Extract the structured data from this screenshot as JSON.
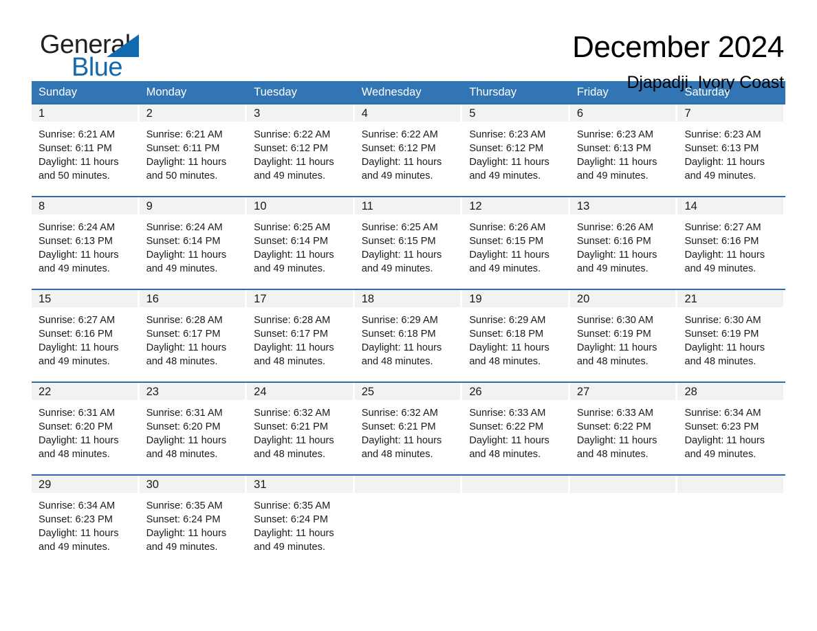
{
  "brand": {
    "name_part1": "General",
    "name_part2": "Blue",
    "triangle_color": "#1369ae",
    "text_color": "#231f20"
  },
  "header": {
    "month_title": "December 2024",
    "location": "Djapadji, Ivory Coast"
  },
  "colors": {
    "header_row_bg": "#3275b4",
    "header_row_text": "#ffffff",
    "week_divider": "#2d6ca8",
    "day_band_bg": "#f2f2f2",
    "body_text": "#1a1a1a"
  },
  "weekdays": [
    "Sunday",
    "Monday",
    "Tuesday",
    "Wednesday",
    "Thursday",
    "Friday",
    "Saturday"
  ],
  "weeks": [
    [
      {
        "day": "1",
        "sunrise": "Sunrise: 6:21 AM",
        "sunset": "Sunset: 6:11 PM",
        "daylight1": "Daylight: 11 hours",
        "daylight2": "and 50 minutes."
      },
      {
        "day": "2",
        "sunrise": "Sunrise: 6:21 AM",
        "sunset": "Sunset: 6:11 PM",
        "daylight1": "Daylight: 11 hours",
        "daylight2": "and 50 minutes."
      },
      {
        "day": "3",
        "sunrise": "Sunrise: 6:22 AM",
        "sunset": "Sunset: 6:12 PM",
        "daylight1": "Daylight: 11 hours",
        "daylight2": "and 49 minutes."
      },
      {
        "day": "4",
        "sunrise": "Sunrise: 6:22 AM",
        "sunset": "Sunset: 6:12 PM",
        "daylight1": "Daylight: 11 hours",
        "daylight2": "and 49 minutes."
      },
      {
        "day": "5",
        "sunrise": "Sunrise: 6:23 AM",
        "sunset": "Sunset: 6:12 PM",
        "daylight1": "Daylight: 11 hours",
        "daylight2": "and 49 minutes."
      },
      {
        "day": "6",
        "sunrise": "Sunrise: 6:23 AM",
        "sunset": "Sunset: 6:13 PM",
        "daylight1": "Daylight: 11 hours",
        "daylight2": "and 49 minutes."
      },
      {
        "day": "7",
        "sunrise": "Sunrise: 6:23 AM",
        "sunset": "Sunset: 6:13 PM",
        "daylight1": "Daylight: 11 hours",
        "daylight2": "and 49 minutes."
      }
    ],
    [
      {
        "day": "8",
        "sunrise": "Sunrise: 6:24 AM",
        "sunset": "Sunset: 6:13 PM",
        "daylight1": "Daylight: 11 hours",
        "daylight2": "and 49 minutes."
      },
      {
        "day": "9",
        "sunrise": "Sunrise: 6:24 AM",
        "sunset": "Sunset: 6:14 PM",
        "daylight1": "Daylight: 11 hours",
        "daylight2": "and 49 minutes."
      },
      {
        "day": "10",
        "sunrise": "Sunrise: 6:25 AM",
        "sunset": "Sunset: 6:14 PM",
        "daylight1": "Daylight: 11 hours",
        "daylight2": "and 49 minutes."
      },
      {
        "day": "11",
        "sunrise": "Sunrise: 6:25 AM",
        "sunset": "Sunset: 6:15 PM",
        "daylight1": "Daylight: 11 hours",
        "daylight2": "and 49 minutes."
      },
      {
        "day": "12",
        "sunrise": "Sunrise: 6:26 AM",
        "sunset": "Sunset: 6:15 PM",
        "daylight1": "Daylight: 11 hours",
        "daylight2": "and 49 minutes."
      },
      {
        "day": "13",
        "sunrise": "Sunrise: 6:26 AM",
        "sunset": "Sunset: 6:16 PM",
        "daylight1": "Daylight: 11 hours",
        "daylight2": "and 49 minutes."
      },
      {
        "day": "14",
        "sunrise": "Sunrise: 6:27 AM",
        "sunset": "Sunset: 6:16 PM",
        "daylight1": "Daylight: 11 hours",
        "daylight2": "and 49 minutes."
      }
    ],
    [
      {
        "day": "15",
        "sunrise": "Sunrise: 6:27 AM",
        "sunset": "Sunset: 6:16 PM",
        "daylight1": "Daylight: 11 hours",
        "daylight2": "and 49 minutes."
      },
      {
        "day": "16",
        "sunrise": "Sunrise: 6:28 AM",
        "sunset": "Sunset: 6:17 PM",
        "daylight1": "Daylight: 11 hours",
        "daylight2": "and 48 minutes."
      },
      {
        "day": "17",
        "sunrise": "Sunrise: 6:28 AM",
        "sunset": "Sunset: 6:17 PM",
        "daylight1": "Daylight: 11 hours",
        "daylight2": "and 48 minutes."
      },
      {
        "day": "18",
        "sunrise": "Sunrise: 6:29 AM",
        "sunset": "Sunset: 6:18 PM",
        "daylight1": "Daylight: 11 hours",
        "daylight2": "and 48 minutes."
      },
      {
        "day": "19",
        "sunrise": "Sunrise: 6:29 AM",
        "sunset": "Sunset: 6:18 PM",
        "daylight1": "Daylight: 11 hours",
        "daylight2": "and 48 minutes."
      },
      {
        "day": "20",
        "sunrise": "Sunrise: 6:30 AM",
        "sunset": "Sunset: 6:19 PM",
        "daylight1": "Daylight: 11 hours",
        "daylight2": "and 48 minutes."
      },
      {
        "day": "21",
        "sunrise": "Sunrise: 6:30 AM",
        "sunset": "Sunset: 6:19 PM",
        "daylight1": "Daylight: 11 hours",
        "daylight2": "and 48 minutes."
      }
    ],
    [
      {
        "day": "22",
        "sunrise": "Sunrise: 6:31 AM",
        "sunset": "Sunset: 6:20 PM",
        "daylight1": "Daylight: 11 hours",
        "daylight2": "and 48 minutes."
      },
      {
        "day": "23",
        "sunrise": "Sunrise: 6:31 AM",
        "sunset": "Sunset: 6:20 PM",
        "daylight1": "Daylight: 11 hours",
        "daylight2": "and 48 minutes."
      },
      {
        "day": "24",
        "sunrise": "Sunrise: 6:32 AM",
        "sunset": "Sunset: 6:21 PM",
        "daylight1": "Daylight: 11 hours",
        "daylight2": "and 48 minutes."
      },
      {
        "day": "25",
        "sunrise": "Sunrise: 6:32 AM",
        "sunset": "Sunset: 6:21 PM",
        "daylight1": "Daylight: 11 hours",
        "daylight2": "and 48 minutes."
      },
      {
        "day": "26",
        "sunrise": "Sunrise: 6:33 AM",
        "sunset": "Sunset: 6:22 PM",
        "daylight1": "Daylight: 11 hours",
        "daylight2": "and 48 minutes."
      },
      {
        "day": "27",
        "sunrise": "Sunrise: 6:33 AM",
        "sunset": "Sunset: 6:22 PM",
        "daylight1": "Daylight: 11 hours",
        "daylight2": "and 48 minutes."
      },
      {
        "day": "28",
        "sunrise": "Sunrise: 6:34 AM",
        "sunset": "Sunset: 6:23 PM",
        "daylight1": "Daylight: 11 hours",
        "daylight2": "and 49 minutes."
      }
    ],
    [
      {
        "day": "29",
        "sunrise": "Sunrise: 6:34 AM",
        "sunset": "Sunset: 6:23 PM",
        "daylight1": "Daylight: 11 hours",
        "daylight2": "and 49 minutes."
      },
      {
        "day": "30",
        "sunrise": "Sunrise: 6:35 AM",
        "sunset": "Sunset: 6:24 PM",
        "daylight1": "Daylight: 11 hours",
        "daylight2": "and 49 minutes."
      },
      {
        "day": "31",
        "sunrise": "Sunrise: 6:35 AM",
        "sunset": "Sunset: 6:24 PM",
        "daylight1": "Daylight: 11 hours",
        "daylight2": "and 49 minutes."
      },
      {
        "day": "",
        "sunrise": "",
        "sunset": "",
        "daylight1": "",
        "daylight2": ""
      },
      {
        "day": "",
        "sunrise": "",
        "sunset": "",
        "daylight1": "",
        "daylight2": ""
      },
      {
        "day": "",
        "sunrise": "",
        "sunset": "",
        "daylight1": "",
        "daylight2": ""
      },
      {
        "day": "",
        "sunrise": "",
        "sunset": "",
        "daylight1": "",
        "daylight2": ""
      }
    ]
  ]
}
